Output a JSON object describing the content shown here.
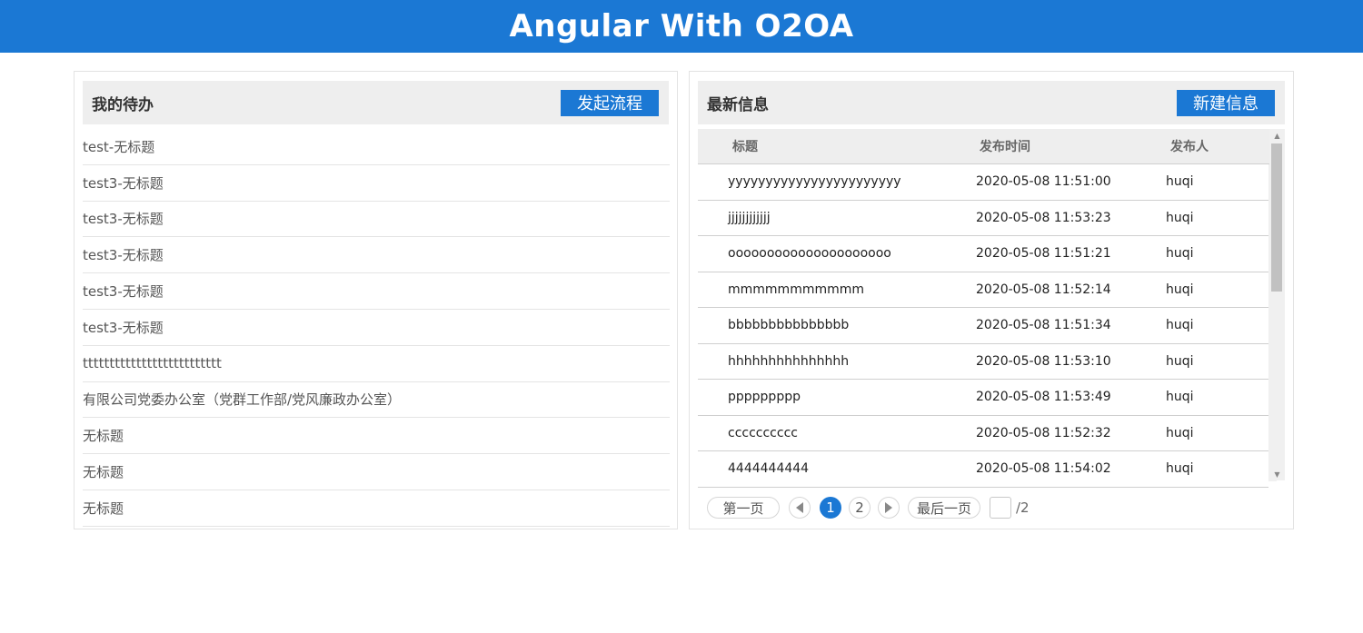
{
  "header": {
    "title": "Angular With O2OA"
  },
  "todo_panel": {
    "title": "我的待办",
    "button_label": "发起流程",
    "items": [
      "test-无标题",
      "test3-无标题",
      "test3-无标题",
      "test3-无标题",
      "test3-无标题",
      "test3-无标题",
      "tttttttttttttttttttttttttt",
      "有限公司党委办公室（党群工作部/党风廉政办公室）",
      "无标题",
      "无标题",
      "无标题"
    ]
  },
  "news_panel": {
    "title": "最新信息",
    "button_label": "新建信息",
    "columns": [
      "标题",
      "发布时间",
      "发布人"
    ],
    "rows": [
      [
        "yyyyyyyyyyyyyyyyyyyyyyy",
        "2020-05-08 11:51:00",
        "huqi"
      ],
      [
        "jjjjjjjjjjjj",
        "2020-05-08 11:53:23",
        "huqi"
      ],
      [
        "ooooooooooooooooooooo",
        "2020-05-08 11:51:21",
        "huqi"
      ],
      [
        "mmmmmmmmmmm",
        "2020-05-08 11:52:14",
        "huqi"
      ],
      [
        "bbbbbbbbbbbbbbb",
        "2020-05-08 11:51:34",
        "huqi"
      ],
      [
        "hhhhhhhhhhhhhhh",
        "2020-05-08 11:53:10",
        "huqi"
      ],
      [
        "ppppppppp",
        "2020-05-08 11:53:49",
        "huqi"
      ],
      [
        "cccccccccc",
        "2020-05-08 11:52:32",
        "huqi"
      ],
      [
        "4444444444",
        "2020-05-08 11:54:02",
        "huqi"
      ]
    ]
  },
  "pager": {
    "first_label": "第一页",
    "pages": [
      "1",
      "2"
    ],
    "current_page": "1",
    "last_label": "最后一页",
    "total": "/2"
  },
  "colors": {
    "brand": "#1b78d4",
    "panel_head": "#eeeeee"
  }
}
